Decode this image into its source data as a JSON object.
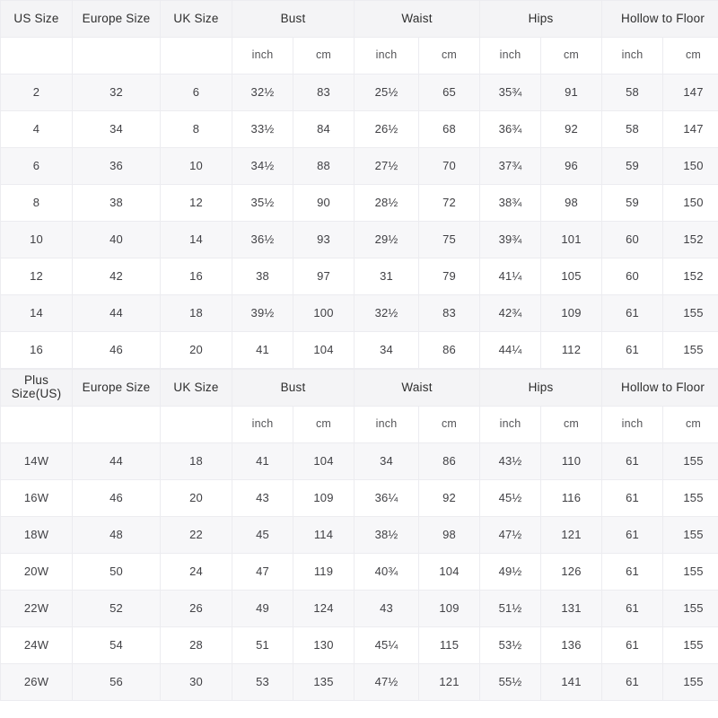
{
  "tables": [
    {
      "id": "standard-size-table",
      "group_headers": [
        {
          "label": "US Size",
          "span": 1
        },
        {
          "label": "Europe Size",
          "span": 1
        },
        {
          "label": "UK Size",
          "span": 1
        },
        {
          "label": "Bust",
          "span": 2
        },
        {
          "label": "Waist",
          "span": 2
        },
        {
          "label": "Hips",
          "span": 2
        },
        {
          "label": "Hollow to Floor",
          "span": 2
        }
      ],
      "unit_headers": [
        "",
        "",
        "",
        "inch",
        "cm",
        "inch",
        "cm",
        "inch",
        "cm",
        "inch",
        "cm"
      ],
      "rows": [
        [
          "2",
          "32",
          "6",
          "32½",
          "83",
          "25½",
          "65",
          "35¾",
          "91",
          "58",
          "147"
        ],
        [
          "4",
          "34",
          "8",
          "33½",
          "84",
          "26½",
          "68",
          "36¾",
          "92",
          "58",
          "147"
        ],
        [
          "6",
          "36",
          "10",
          "34½",
          "88",
          "27½",
          "70",
          "37¾",
          "96",
          "59",
          "150"
        ],
        [
          "8",
          "38",
          "12",
          "35½",
          "90",
          "28½",
          "72",
          "38¾",
          "98",
          "59",
          "150"
        ],
        [
          "10",
          "40",
          "14",
          "36½",
          "93",
          "29½",
          "75",
          "39¾",
          "101",
          "60",
          "152"
        ],
        [
          "12",
          "42",
          "16",
          "38",
          "97",
          "31",
          "79",
          "41¼",
          "105",
          "60",
          "152"
        ],
        [
          "14",
          "44",
          "18",
          "39½",
          "100",
          "32½",
          "83",
          "42¾",
          "109",
          "61",
          "155"
        ],
        [
          "16",
          "46",
          "20",
          "41",
          "104",
          "34",
          "86",
          "44¼",
          "112",
          "61",
          "155"
        ]
      ]
    },
    {
      "id": "plus-size-table",
      "group_headers": [
        {
          "label": "Plus Size(US)",
          "span": 1
        },
        {
          "label": "Europe Size",
          "span": 1
        },
        {
          "label": "UK Size",
          "span": 1
        },
        {
          "label": "Bust",
          "span": 2
        },
        {
          "label": "Waist",
          "span": 2
        },
        {
          "label": "Hips",
          "span": 2
        },
        {
          "label": "Hollow to Floor",
          "span": 2
        }
      ],
      "unit_headers": [
        "",
        "",
        "",
        "inch",
        "cm",
        "inch",
        "cm",
        "inch",
        "cm",
        "inch",
        "cm"
      ],
      "rows": [
        [
          "14W",
          "44",
          "18",
          "41",
          "104",
          "34",
          "86",
          "43½",
          "110",
          "61",
          "155"
        ],
        [
          "16W",
          "46",
          "20",
          "43",
          "109",
          "36¼",
          "92",
          "45½",
          "116",
          "61",
          "155"
        ],
        [
          "18W",
          "48",
          "22",
          "45",
          "114",
          "38½",
          "98",
          "47½",
          "121",
          "61",
          "155"
        ],
        [
          "20W",
          "50",
          "24",
          "47",
          "119",
          "40¾",
          "104",
          "49½",
          "126",
          "61",
          "155"
        ],
        [
          "22W",
          "52",
          "26",
          "49",
          "124",
          "43",
          "109",
          "51½",
          "131",
          "61",
          "155"
        ],
        [
          "24W",
          "54",
          "28",
          "51",
          "130",
          "45¼",
          "115",
          "53½",
          "136",
          "61",
          "155"
        ],
        [
          "26W",
          "56",
          "30",
          "53",
          "135",
          "47½",
          "121",
          "55½",
          "141",
          "61",
          "155"
        ]
      ]
    }
  ],
  "colors": {
    "header_bg": "#f4f4f6",
    "row_odd_bg": "#f7f7f9",
    "row_even_bg": "#ffffff",
    "border": "#ececf0",
    "text": "#414145"
  }
}
